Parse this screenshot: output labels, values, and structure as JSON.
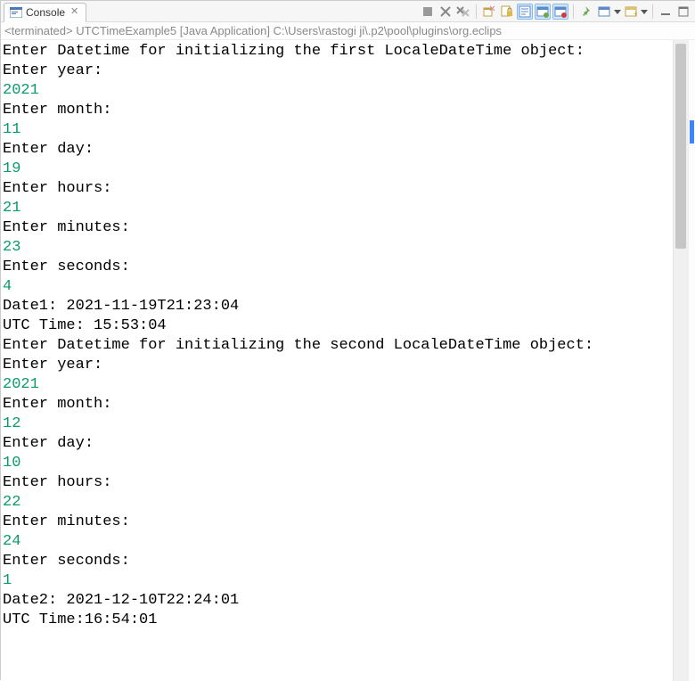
{
  "tab": {
    "label": "Console"
  },
  "status": "<terminated> UTCTimeExample5 [Java Application] C:\\Users\\rastogi ji\\.p2\\pool\\plugins\\org.eclips",
  "lines": [
    {
      "t": "Enter Datetime for initializing the first LocaleDateTime object:",
      "kind": "out"
    },
    {
      "t": "Enter year:",
      "kind": "out"
    },
    {
      "t": "2021",
      "kind": "in"
    },
    {
      "t": "Enter month:",
      "kind": "out"
    },
    {
      "t": "11",
      "kind": "in"
    },
    {
      "t": "Enter day:",
      "kind": "out"
    },
    {
      "t": "19",
      "kind": "in"
    },
    {
      "t": "Enter hours:",
      "kind": "out"
    },
    {
      "t": "21",
      "kind": "in"
    },
    {
      "t": "Enter minutes:",
      "kind": "out"
    },
    {
      "t": "23",
      "kind": "in"
    },
    {
      "t": "Enter seconds:",
      "kind": "out"
    },
    {
      "t": "4",
      "kind": "in"
    },
    {
      "t": "Date1: 2021-11-19T21:23:04",
      "kind": "out"
    },
    {
      "t": "UTC Time: 15:53:04",
      "kind": "out"
    },
    {
      "t": "Enter Datetime for initializing the second LocaleDateTime object:",
      "kind": "out"
    },
    {
      "t": "Enter year:",
      "kind": "out"
    },
    {
      "t": "2021",
      "kind": "in"
    },
    {
      "t": "Enter month:",
      "kind": "out"
    },
    {
      "t": "12",
      "kind": "in"
    },
    {
      "t": "Enter day:",
      "kind": "out"
    },
    {
      "t": "10",
      "kind": "in"
    },
    {
      "t": "Enter hours:",
      "kind": "out"
    },
    {
      "t": "22",
      "kind": "in"
    },
    {
      "t": "Enter minutes:",
      "kind": "out"
    },
    {
      "t": "24",
      "kind": "in"
    },
    {
      "t": "Enter seconds:",
      "kind": "out"
    },
    {
      "t": "1",
      "kind": "in"
    },
    {
      "t": "Date2: 2021-12-10T22:24:01",
      "kind": "out"
    },
    {
      "t": "UTC Time:16:54:01",
      "kind": "out"
    }
  ],
  "toolbar": {
    "terminate": "terminate-icon",
    "remove_launch": "remove-launch-icon",
    "remove_all": "remove-all-terminated-icon",
    "clear": "clear-console-icon",
    "scroll_lock": "scroll-lock-icon",
    "word_wrap": "word-wrap-icon",
    "show_on_out": "show-on-stdout-icon",
    "show_on_err": "show-on-stderr-icon",
    "pin": "pin-console-icon",
    "display_console": "display-selected-console-icon",
    "open_console": "open-console-icon",
    "minimize": "minimize-icon",
    "maximize": "maximize-icon"
  }
}
